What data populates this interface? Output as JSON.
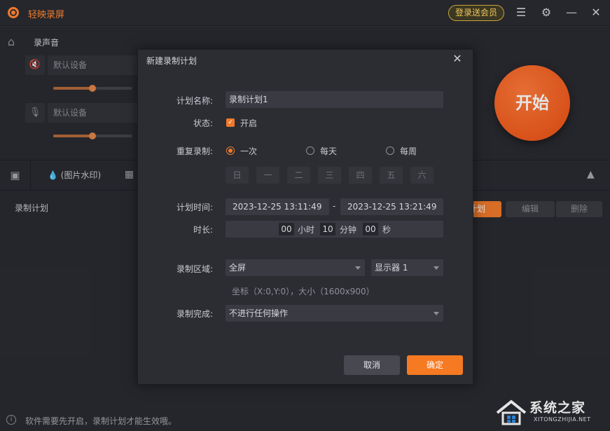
{
  "app": {
    "title": "轻映录屏",
    "vip_label": "登录送会员",
    "menu_icon": "menu-icon",
    "settings_icon": "settings-icon",
    "minimize_icon": "minimize-icon",
    "close_icon": "close-icon"
  },
  "sound": {
    "label": "录声音",
    "speaker_device": "默认设备",
    "mic_device": "默认设备",
    "speaker_volume": 0.5,
    "mic_volume": 0.5
  },
  "start_label": "开始",
  "toolbar": {
    "watermark_label": "(图片水印)"
  },
  "plans": {
    "label": "录制计划",
    "add_label": "计划",
    "edit_label": "编辑",
    "delete_label": "删除"
  },
  "footer": {
    "info_glyph": "i",
    "text": "软件需要先开启，录制计划才能生效哦。"
  },
  "brand": {
    "name": "系统之家",
    "url": "XITONGZHIJIA.NET"
  },
  "dialog": {
    "title": "新建录制计划",
    "name_label": "计划名称:",
    "name_value": "录制计划1",
    "status_label": "状态:",
    "status_value": "开启",
    "status_checked": true,
    "repeat_label": "重复录制:",
    "repeat_options": [
      "一次",
      "每天",
      "每周"
    ],
    "repeat_selected": "一次",
    "weekdays": [
      "日",
      "一",
      "二",
      "三",
      "四",
      "五",
      "六"
    ],
    "time_label": "计划时间:",
    "start_time": "2023-12-25 13:11:49",
    "time_sep": "-",
    "end_time": "2023-12-25 13:21:49",
    "duration_label": "时长:",
    "duration_hours": "00",
    "hours_unit": "小时",
    "duration_minutes": "10",
    "minutes_unit": "分钟",
    "duration_seconds": "00",
    "seconds_unit": "秒",
    "area_label": "录制区域:",
    "area_value": "全屏",
    "display_value": "显示器 1",
    "coords_text": "坐标（X:0,Y:0），大小（1600x900）",
    "complete_label": "录制完成:",
    "complete_value": "不进行任何操作",
    "cancel_label": "取消",
    "ok_label": "确定"
  }
}
